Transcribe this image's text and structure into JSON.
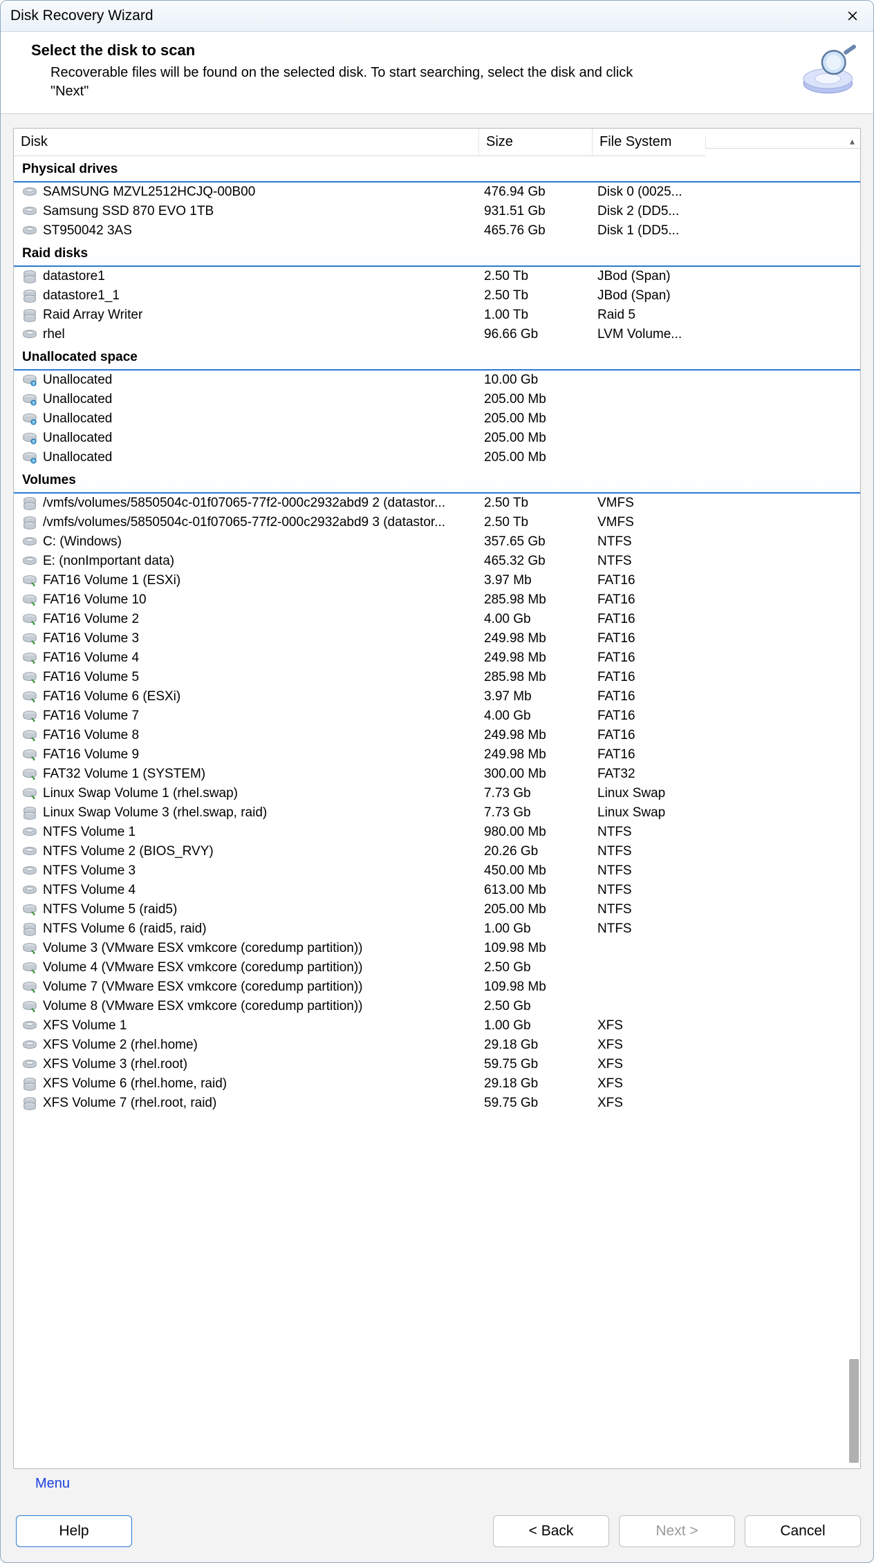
{
  "window": {
    "title": "Disk Recovery Wizard"
  },
  "header": {
    "heading": "Select the disk to scan",
    "sub": "Recoverable files will be found on the selected disk. To start searching, select the disk and click \"Next\""
  },
  "columns": {
    "disk": "Disk",
    "size": "Size",
    "fs": "File System"
  },
  "menu_label": "Menu",
  "buttons": {
    "help": "Help",
    "back": "<  Back",
    "next": "Next  >",
    "cancel": "Cancel"
  },
  "groups": [
    {
      "title": "Physical drives",
      "rows": [
        {
          "icon": "hdd",
          "name": "SAMSUNG MZVL2512HCJQ-00B00",
          "size": "476.94 Gb",
          "fs": "Disk 0 (0025..."
        },
        {
          "icon": "hdd",
          "name": "Samsung SSD 870 EVO 1TB",
          "size": "931.51 Gb",
          "fs": "Disk 2 (DD5..."
        },
        {
          "icon": "hdd",
          "name": "ST950042 3AS",
          "size": "465.76 Gb",
          "fs": "Disk 1 (DD5..."
        }
      ]
    },
    {
      "title": "Raid disks",
      "rows": [
        {
          "icon": "raid",
          "name": "datastore1",
          "size": "2.50 Tb",
          "fs": "JBod (Span)"
        },
        {
          "icon": "raid",
          "name": "datastore1_1",
          "size": "2.50 Tb",
          "fs": "JBod (Span)"
        },
        {
          "icon": "raid",
          "name": "Raid Array Writer",
          "size": "1.00 Tb",
          "fs": "Raid 5"
        },
        {
          "icon": "hdd",
          "name": "rhel",
          "size": "96.66 Gb",
          "fs": "LVM Volume..."
        }
      ]
    },
    {
      "title": "Unallocated space",
      "rows": [
        {
          "icon": "unalloc",
          "name": "Unallocated",
          "size": "10.00 Gb",
          "fs": ""
        },
        {
          "icon": "unalloc",
          "name": "Unallocated",
          "size": "205.00 Mb",
          "fs": ""
        },
        {
          "icon": "unalloc",
          "name": "Unallocated",
          "size": "205.00 Mb",
          "fs": ""
        },
        {
          "icon": "unalloc",
          "name": "Unallocated",
          "size": "205.00 Mb",
          "fs": ""
        },
        {
          "icon": "unalloc",
          "name": "Unallocated",
          "size": "205.00 Mb",
          "fs": ""
        }
      ]
    },
    {
      "title": "Volumes",
      "rows": [
        {
          "icon": "raid",
          "name": "/vmfs/volumes/5850504c-01f07065-77f2-000c2932abd9 2 (datastor...",
          "size": "2.50 Tb",
          "fs": "VMFS"
        },
        {
          "icon": "raid",
          "name": "/vmfs/volumes/5850504c-01f07065-77f2-000c2932abd9 3 (datastor...",
          "size": "2.50 Tb",
          "fs": "VMFS"
        },
        {
          "icon": "hdd",
          "name": "C: (Windows)",
          "size": "357.65 Gb",
          "fs": "NTFS"
        },
        {
          "icon": "hdd",
          "name": "E: (nonImportant data)",
          "size": "465.32 Gb",
          "fs": "NTFS"
        },
        {
          "icon": "vol",
          "name": "FAT16 Volume 1 (ESXi)",
          "size": "3.97 Mb",
          "fs": "FAT16"
        },
        {
          "icon": "vol",
          "name": "FAT16 Volume 10",
          "size": "285.98 Mb",
          "fs": "FAT16"
        },
        {
          "icon": "vol",
          "name": "FAT16 Volume 2",
          "size": "4.00 Gb",
          "fs": "FAT16"
        },
        {
          "icon": "vol",
          "name": "FAT16 Volume 3",
          "size": "249.98 Mb",
          "fs": "FAT16"
        },
        {
          "icon": "vol",
          "name": "FAT16 Volume 4",
          "size": "249.98 Mb",
          "fs": "FAT16"
        },
        {
          "icon": "vol",
          "name": "FAT16 Volume 5",
          "size": "285.98 Mb",
          "fs": "FAT16"
        },
        {
          "icon": "vol",
          "name": "FAT16 Volume 6 (ESXi)",
          "size": "3.97 Mb",
          "fs": "FAT16"
        },
        {
          "icon": "vol",
          "name": "FAT16 Volume 7",
          "size": "4.00 Gb",
          "fs": "FAT16"
        },
        {
          "icon": "vol",
          "name": "FAT16 Volume 8",
          "size": "249.98 Mb",
          "fs": "FAT16"
        },
        {
          "icon": "vol",
          "name": "FAT16 Volume 9",
          "size": "249.98 Mb",
          "fs": "FAT16"
        },
        {
          "icon": "vol",
          "name": "FAT32 Volume 1 (SYSTEM)",
          "size": "300.00 Mb",
          "fs": "FAT32"
        },
        {
          "icon": "vol",
          "name": "Linux Swap Volume 1 (rhel.swap)",
          "size": "7.73 Gb",
          "fs": "Linux Swap"
        },
        {
          "icon": "raid",
          "name": "Linux Swap Volume 3 (rhel.swap, raid)",
          "size": "7.73 Gb",
          "fs": "Linux Swap"
        },
        {
          "icon": "hdd",
          "name": "NTFS Volume 1",
          "size": "980.00 Mb",
          "fs": "NTFS"
        },
        {
          "icon": "hdd",
          "name": "NTFS Volume 2 (BIOS_RVY)",
          "size": "20.26 Gb",
          "fs": "NTFS"
        },
        {
          "icon": "hdd",
          "name": "NTFS Volume 3",
          "size": "450.00 Mb",
          "fs": "NTFS"
        },
        {
          "icon": "hdd",
          "name": "NTFS Volume 4",
          "size": "613.00 Mb",
          "fs": "NTFS"
        },
        {
          "icon": "vol",
          "name": "NTFS Volume 5 (raid5)",
          "size": "205.00 Mb",
          "fs": "NTFS"
        },
        {
          "icon": "raid",
          "name": "NTFS Volume 6 (raid5, raid)",
          "size": "1.00 Gb",
          "fs": "NTFS"
        },
        {
          "icon": "vol",
          "name": "Volume 3 (VMware ESX vmkcore (coredump partition))",
          "size": "109.98 Mb",
          "fs": ""
        },
        {
          "icon": "vol",
          "name": "Volume 4 (VMware ESX vmkcore (coredump partition))",
          "size": "2.50 Gb",
          "fs": ""
        },
        {
          "icon": "vol",
          "name": "Volume 7 (VMware ESX vmkcore (coredump partition))",
          "size": "109.98 Mb",
          "fs": ""
        },
        {
          "icon": "vol",
          "name": "Volume 8 (VMware ESX vmkcore (coredump partition))",
          "size": "2.50 Gb",
          "fs": ""
        },
        {
          "icon": "hdd",
          "name": "XFS Volume 1",
          "size": "1.00 Gb",
          "fs": "XFS"
        },
        {
          "icon": "hdd",
          "name": "XFS Volume 2 (rhel.home)",
          "size": "29.18 Gb",
          "fs": "XFS"
        },
        {
          "icon": "hdd",
          "name": "XFS Volume 3 (rhel.root)",
          "size": "59.75 Gb",
          "fs": "XFS"
        },
        {
          "icon": "raid",
          "name": "XFS Volume 6 (rhel.home, raid)",
          "size": "29.18 Gb",
          "fs": "XFS"
        },
        {
          "icon": "raid",
          "name": "XFS Volume 7 (rhel.root, raid)",
          "size": "59.75 Gb",
          "fs": "XFS"
        }
      ]
    }
  ]
}
